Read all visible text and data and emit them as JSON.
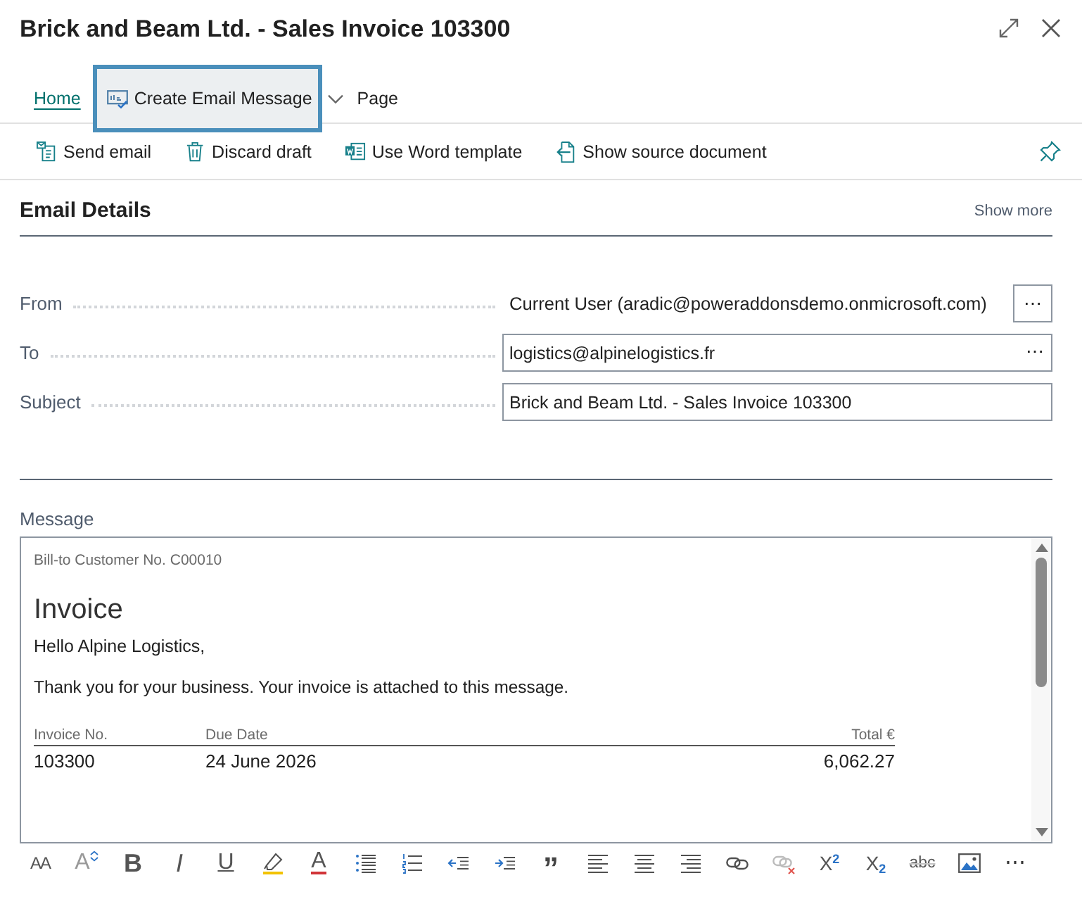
{
  "window": {
    "title": "Brick and Beam Ltd. - Sales Invoice 103300"
  },
  "action_tabs": [
    {
      "label": "Home",
      "kind": "tab",
      "selected": true,
      "highlighted": false,
      "dropdown": false
    },
    {
      "label": "Create Email Message",
      "kind": "action",
      "selected": false,
      "highlighted": true,
      "dropdown": true
    },
    {
      "label": "Page",
      "kind": "tab",
      "selected": false,
      "highlighted": false,
      "dropdown": false
    }
  ],
  "actions": [
    {
      "label": "Send email",
      "kind": "send"
    },
    {
      "label": "Discard draft",
      "kind": "discard"
    },
    {
      "label": "Use Word template",
      "kind": "word"
    },
    {
      "label": "Show source document",
      "kind": "source"
    }
  ],
  "section": {
    "title": "Email Details",
    "show_more": "Show more"
  },
  "fields": [
    {
      "label": "From",
      "kind": "display",
      "value": "Current User (aradic@poweraddonsdemo.onmicrosoft.com)",
      "button": "⋯"
    },
    {
      "label": "To",
      "kind": "input",
      "value": "logistics@alpinelogistics.fr",
      "button": "⋯"
    },
    {
      "label": "Subject",
      "kind": "input",
      "value": "Brick and Beam Ltd. - Sales Invoice 103300"
    }
  ],
  "message": {
    "label": "Message",
    "customer_no": "Bill-to Customer No. C00010",
    "heading": "Invoice",
    "greeting": "Hello Alpine Logistics,",
    "text": "Thank you for your business. Your invoice is attached to this message.",
    "table": {
      "columns": [
        "Invoice No.",
        "Due Date",
        "Total €"
      ],
      "rows": [
        [
          "103300",
          "24 June 2026",
          "6,062.27"
        ]
      ]
    }
  },
  "format_toolbar": [
    {
      "kind": "font-size",
      "label": "AA",
      "disabled": false
    },
    {
      "kind": "grow-font",
      "label": "A",
      "disabled": false
    },
    {
      "kind": "bold",
      "label": "B",
      "disabled": false
    },
    {
      "kind": "italic",
      "label": "I",
      "disabled": false
    },
    {
      "kind": "underline",
      "label": "U",
      "disabled": false
    },
    {
      "kind": "highlight",
      "disabled": false
    },
    {
      "kind": "font-color",
      "label": "A",
      "disabled": false
    },
    {
      "kind": "bullets",
      "disabled": false
    },
    {
      "kind": "numbering",
      "disabled": false
    },
    {
      "kind": "outdent",
      "disabled": false
    },
    {
      "kind": "indent",
      "disabled": false
    },
    {
      "kind": "quote",
      "label": "”",
      "disabled": false
    },
    {
      "kind": "align-left",
      "disabled": false
    },
    {
      "kind": "align-center",
      "disabled": false
    },
    {
      "kind": "align-right",
      "disabled": false
    },
    {
      "kind": "link",
      "disabled": false
    },
    {
      "kind": "unlink",
      "disabled": true
    },
    {
      "kind": "superscript",
      "label": "X$^{2}$",
      "disabled": false
    },
    {
      "kind": "subscript",
      "label": "X$_{2}$",
      "disabled": false
    },
    {
      "kind": "strikethrough",
      "label": "abc",
      "disabled": false
    },
    {
      "kind": "image",
      "disabled": false
    },
    {
      "kind": "more",
      "label": "⋯",
      "disabled": false
    }
  ]
}
